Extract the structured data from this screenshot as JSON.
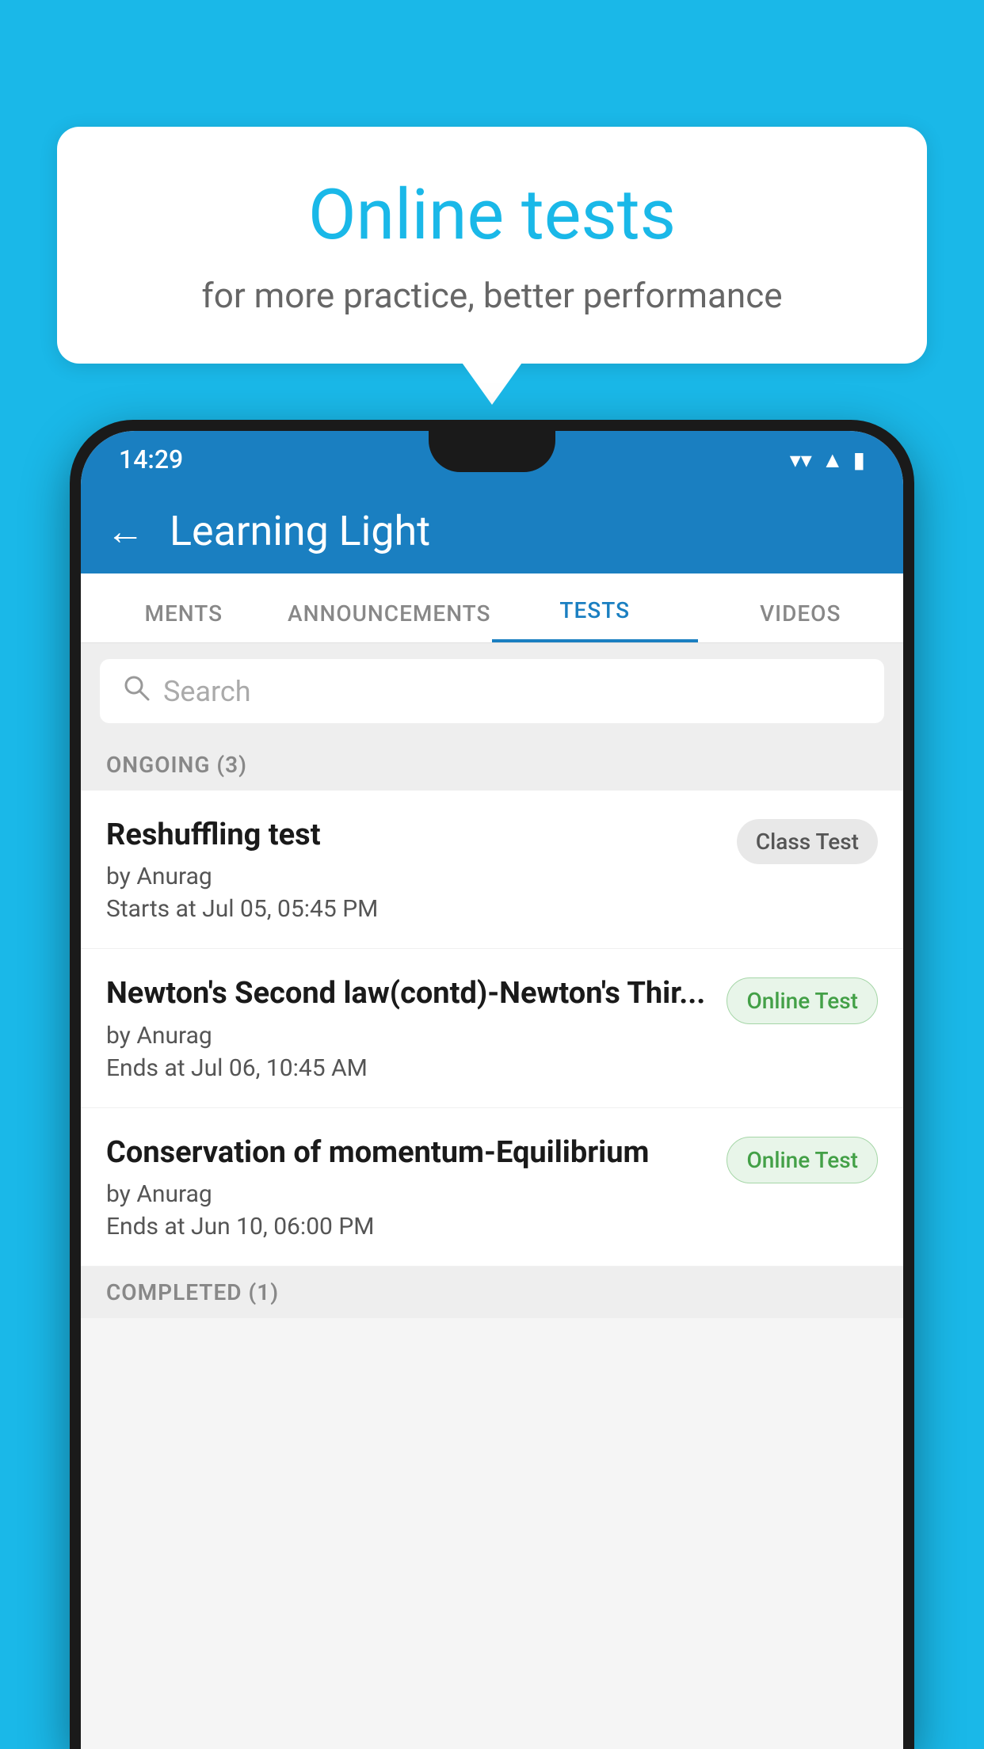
{
  "background_color": "#1ab8e8",
  "bubble": {
    "title": "Online tests",
    "subtitle": "for more practice, better performance"
  },
  "phone": {
    "status_bar": {
      "time": "14:29",
      "wifi_icon": "▼",
      "signal_icon": "▲",
      "battery_icon": "▮"
    },
    "app_bar": {
      "back_label": "←",
      "title": "Learning Light"
    },
    "tabs": [
      {
        "label": "MENTS",
        "active": false
      },
      {
        "label": "ANNOUNCEMENTS",
        "active": false
      },
      {
        "label": "TESTS",
        "active": true
      },
      {
        "label": "VIDEOS",
        "active": false
      }
    ],
    "search": {
      "placeholder": "Search",
      "icon": "🔍"
    },
    "sections": [
      {
        "header": "ONGOING (3)",
        "tests": [
          {
            "title": "Reshuffling test",
            "author": "by Anurag",
            "date": "Starts at  Jul 05, 05:45 PM",
            "badge": "Class Test",
            "badge_type": "class"
          },
          {
            "title": "Newton's Second law(contd)-Newton's Thir...",
            "author": "by Anurag",
            "date": "Ends at  Jul 06, 10:45 AM",
            "badge": "Online Test",
            "badge_type": "online"
          },
          {
            "title": "Conservation of momentum-Equilibrium",
            "author": "by Anurag",
            "date": "Ends at  Jun 10, 06:00 PM",
            "badge": "Online Test",
            "badge_type": "online"
          }
        ]
      }
    ],
    "completed_header": "COMPLETED (1)"
  }
}
